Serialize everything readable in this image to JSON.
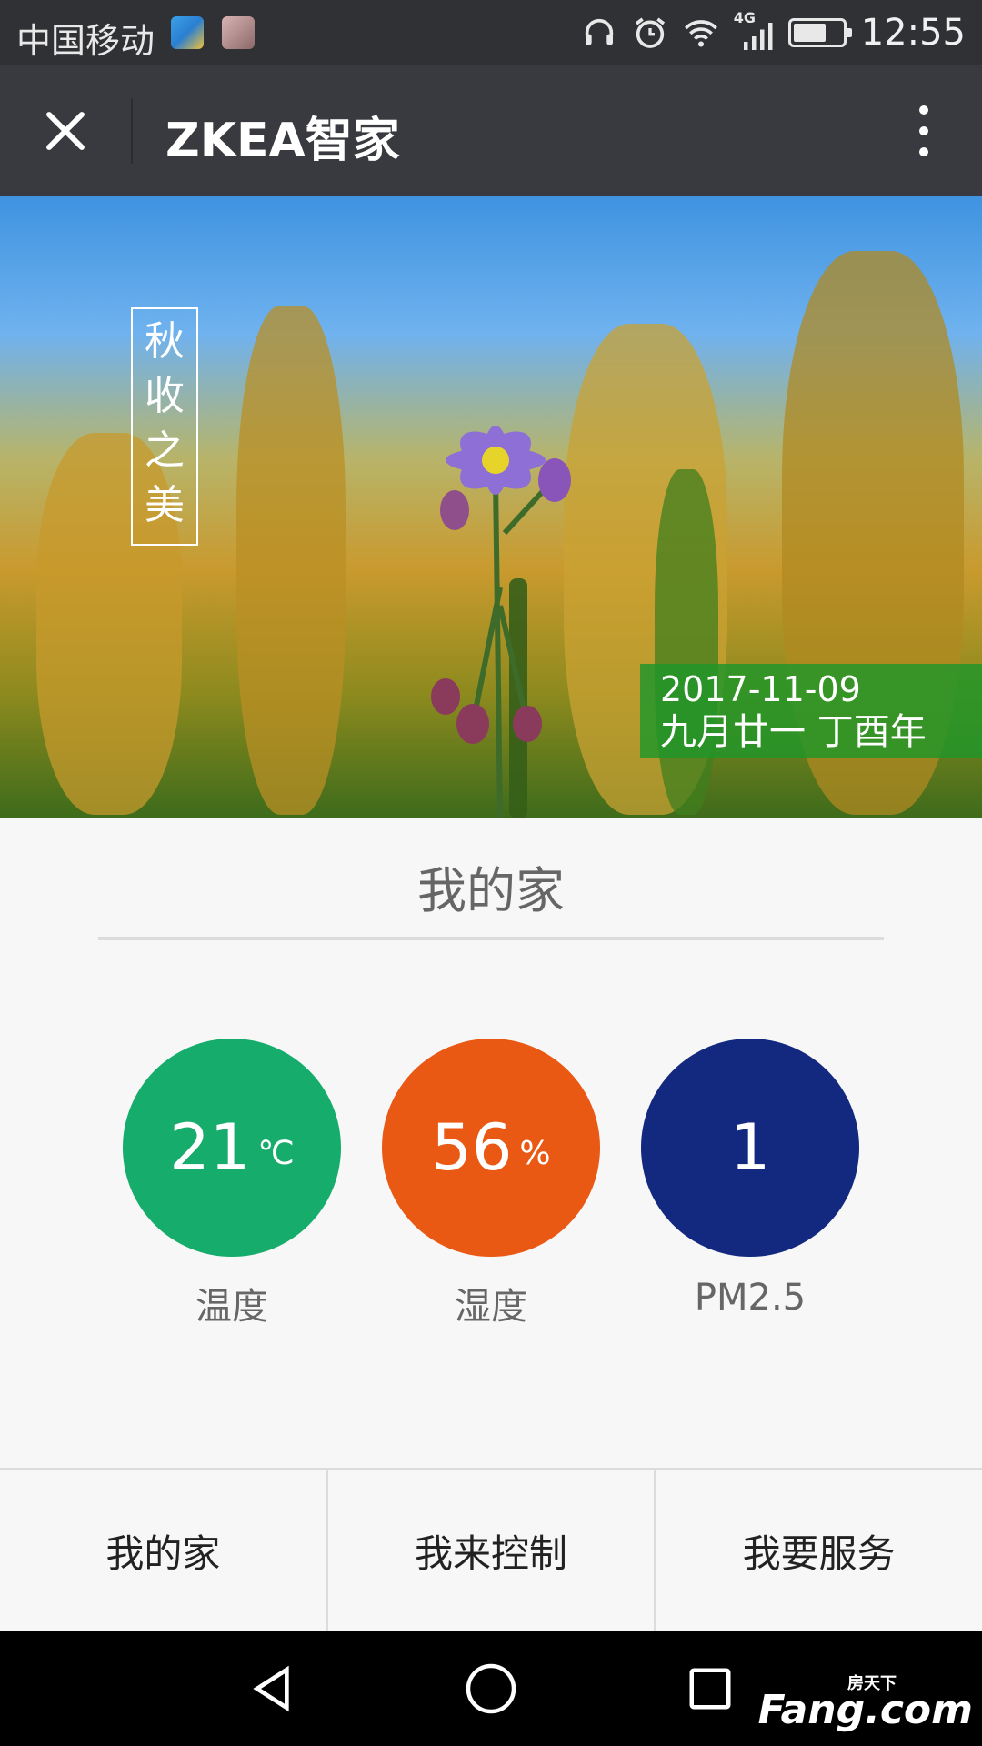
{
  "status_bar": {
    "carrier": "中国移动",
    "network": "4G",
    "time": "12:55",
    "icons": [
      "headphones-icon",
      "alarm-icon",
      "wifi-icon",
      "signal-icon",
      "battery-icon"
    ]
  },
  "title_bar": {
    "title": "ZKEA智家",
    "close_icon": "close-icon",
    "more_icon": "more-vertical-icon"
  },
  "banner": {
    "poem": [
      "秋",
      "收",
      "之",
      "美"
    ],
    "date": "2017-11-09",
    "lunar": "九月廿一 丁酉年"
  },
  "home": {
    "title": "我的家",
    "metrics": [
      {
        "value": "21",
        "unit": "℃",
        "label": "温度",
        "color": "#16ac6b"
      },
      {
        "value": "56",
        "unit": "%",
        "label": "湿度",
        "color": "#e95914"
      },
      {
        "value": "1",
        "unit": "",
        "label": "PM2.5",
        "color": "#13287f"
      }
    ]
  },
  "tabs": [
    "我的家",
    "我来控制",
    "我要服务"
  ],
  "nav": {
    "back_icon": "back-triangle-icon",
    "home_icon": "home-circle-icon",
    "recent_icon": "recent-square-icon"
  },
  "watermark": {
    "small": "房天下",
    "text": "Fang.com"
  }
}
